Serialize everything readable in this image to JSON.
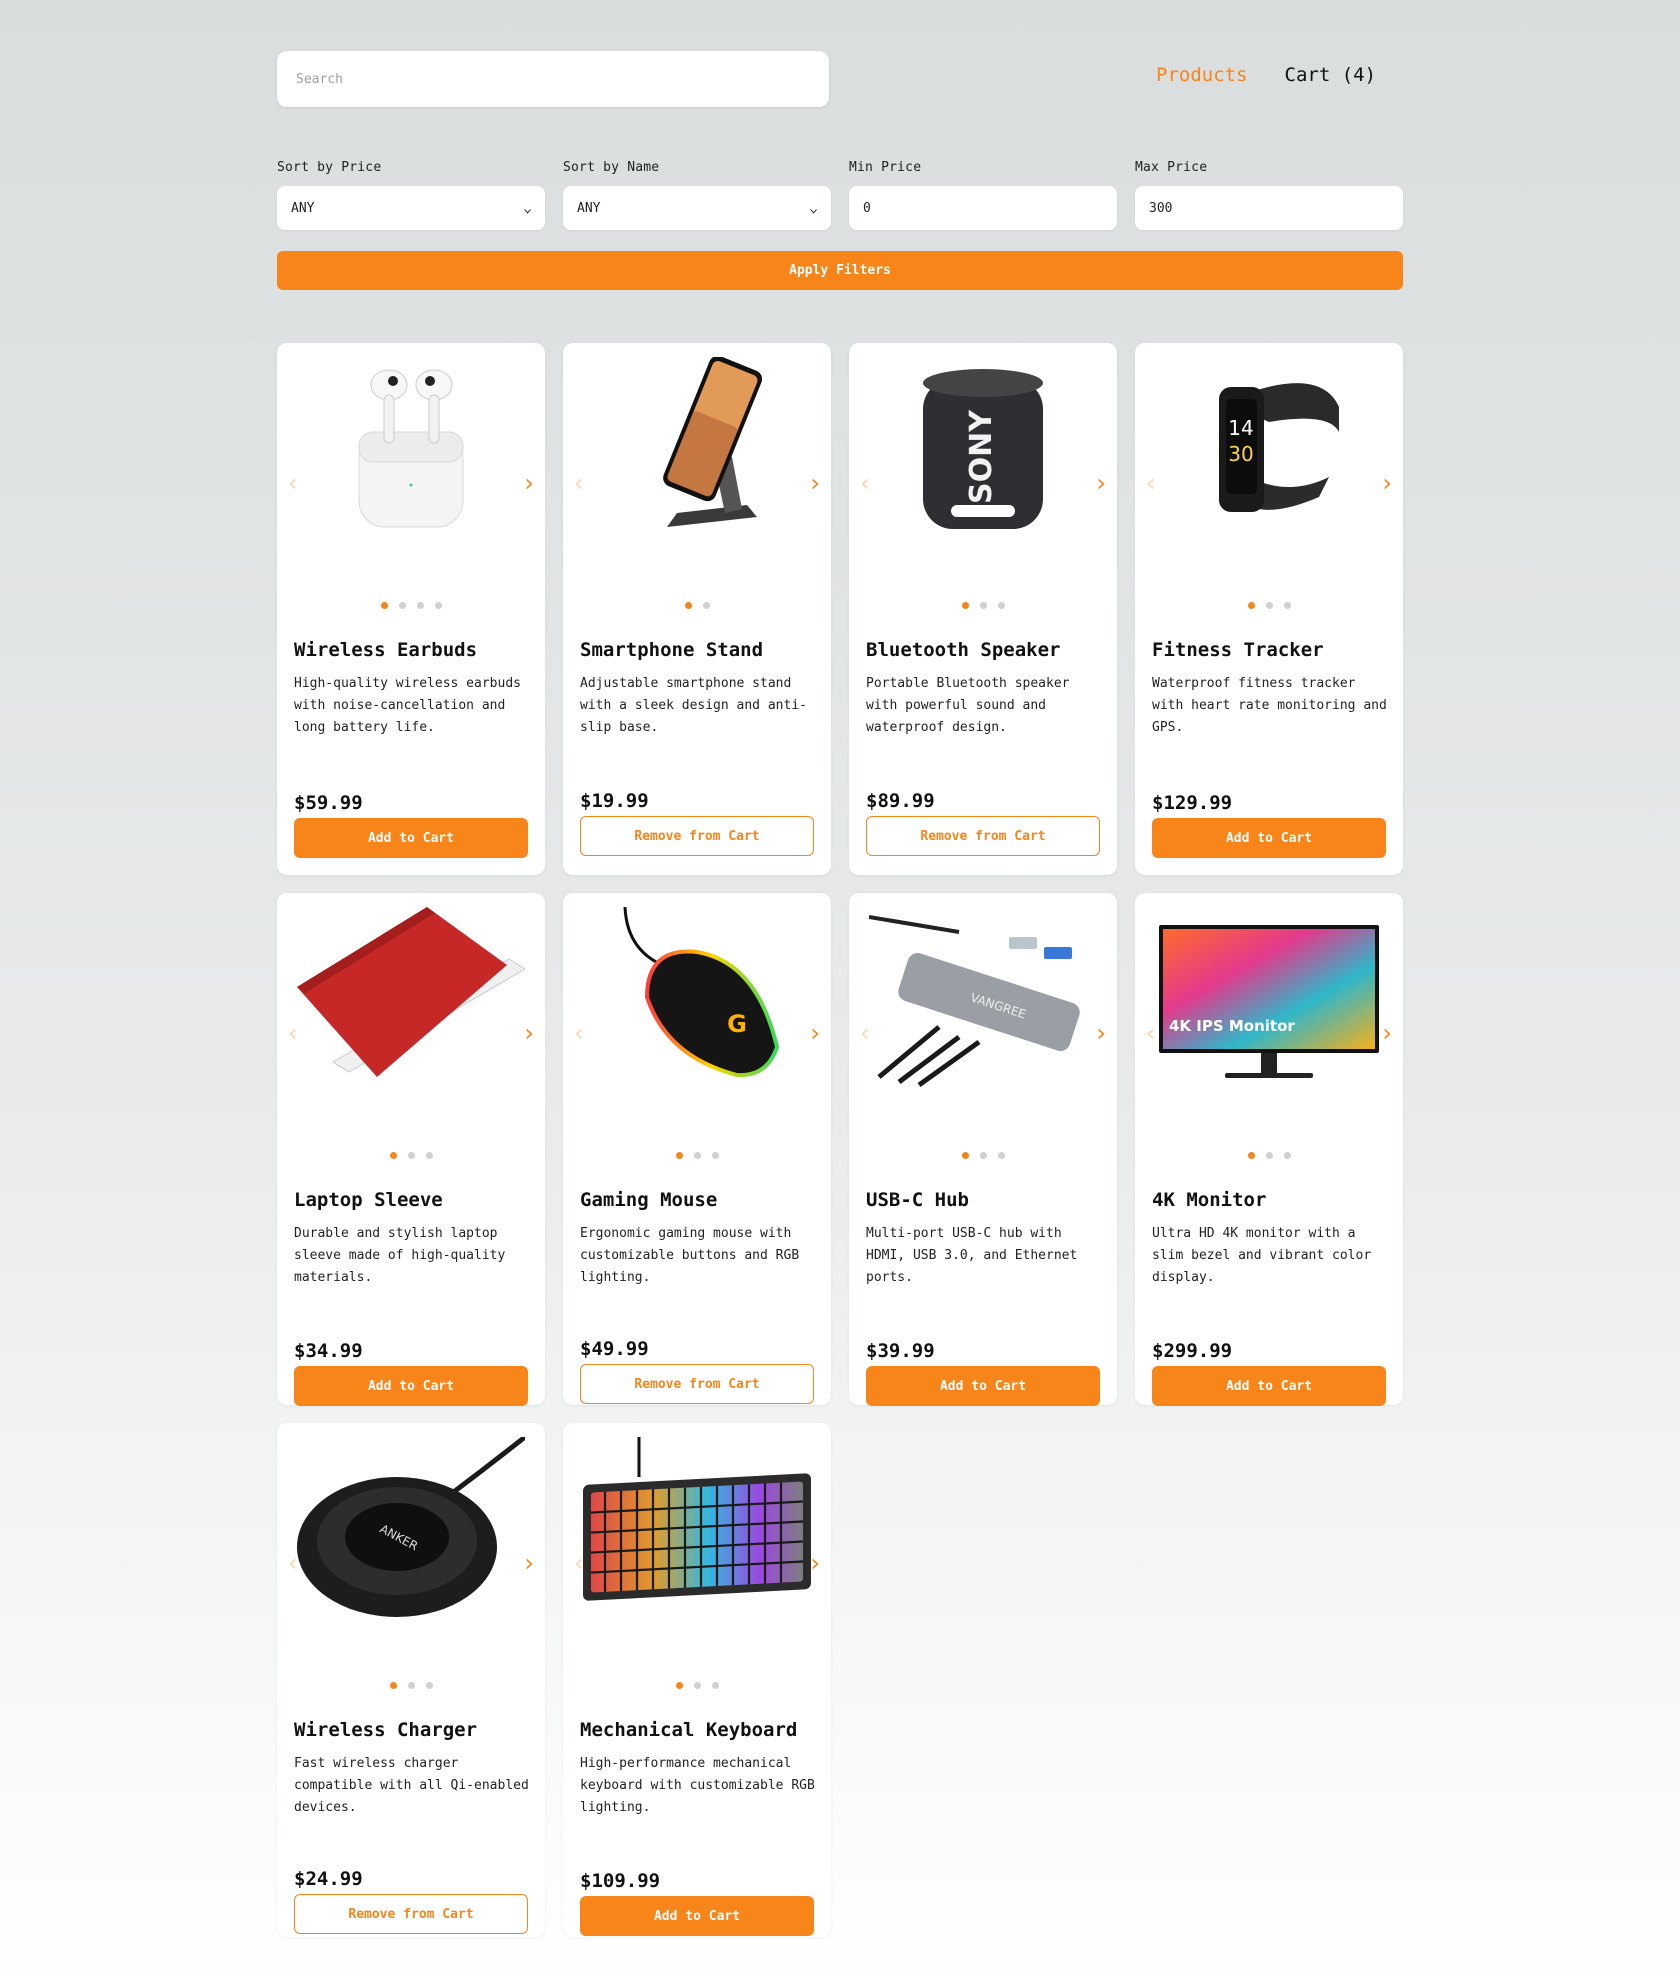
{
  "search": {
    "placeholder": "Search"
  },
  "nav": {
    "products": "Products",
    "cart": "Cart (4)"
  },
  "filters": {
    "sort_price_label": "Sort by Price",
    "sort_price_value": "ANY",
    "sort_name_label": "Sort by Name",
    "sort_name_value": "ANY",
    "min_label": "Min Price",
    "min_value": "0",
    "max_label": "Max Price",
    "max_value": "300",
    "apply": "Apply Filters"
  },
  "colors": {
    "accent": "#f7851a"
  },
  "products": [
    {
      "name": "Wireless Earbuds",
      "desc": "High-quality wireless earbuds with noise-cancellation and long battery life.",
      "price": "$59.99",
      "action": "Add to Cart",
      "images": 4,
      "icon": "earbuds-image"
    },
    {
      "name": "Smartphone Stand",
      "desc": "Adjustable smartphone stand with a sleek design and anti-slip base.",
      "price": "$19.99",
      "action": "Remove from Cart",
      "images": 2,
      "icon": "phone-stand-image"
    },
    {
      "name": "Bluetooth Speaker",
      "desc": "Portable Bluetooth speaker with powerful sound and waterproof design.",
      "price": "$89.99",
      "action": "Remove from Cart",
      "images": 3,
      "icon": "speaker-image",
      "brand": "SONY"
    },
    {
      "name": "Fitness Tracker",
      "desc": "Waterproof fitness tracker with heart rate monitoring and GPS.",
      "price": "$129.99",
      "action": "Add to Cart",
      "images": 3,
      "icon": "fitness-tracker-image"
    },
    {
      "name": "Laptop Sleeve",
      "desc": "Durable and stylish laptop sleeve made of high-quality materials.",
      "price": "$34.99",
      "action": "Add to Cart",
      "images": 3,
      "icon": "laptop-sleeve-image"
    },
    {
      "name": "Gaming Mouse",
      "desc": "Ergonomic gaming mouse with customizable buttons and RGB lighting.",
      "price": "$49.99",
      "action": "Remove from Cart",
      "images": 3,
      "icon": "mouse-image"
    },
    {
      "name": "USB-C Hub",
      "desc": "Multi-port USB-C hub with HDMI, USB 3.0, and Ethernet ports.",
      "price": "$39.99",
      "action": "Add to Cart",
      "images": 3,
      "icon": "usb-hub-image",
      "brand": "VANGREE"
    },
    {
      "name": "4K Monitor",
      "desc": "Ultra HD 4K monitor with a slim bezel and vibrant color display.",
      "price": "$299.99",
      "action": "Add to Cart",
      "images": 3,
      "icon": "monitor-image",
      "overlay": "4K IPS Monitor"
    },
    {
      "name": "Wireless Charger",
      "desc": "Fast wireless charger compatible with all Qi-enabled devices.",
      "price": "$24.99",
      "action": "Remove from Cart",
      "images": 3,
      "icon": "charger-image",
      "brand": "ANKER"
    },
    {
      "name": "Mechanical Keyboard",
      "desc": "High-performance mechanical keyboard with customizable RGB lighting.",
      "price": "$109.99",
      "action": "Add to Cart",
      "images": 3,
      "icon": "keyboard-image"
    }
  ]
}
